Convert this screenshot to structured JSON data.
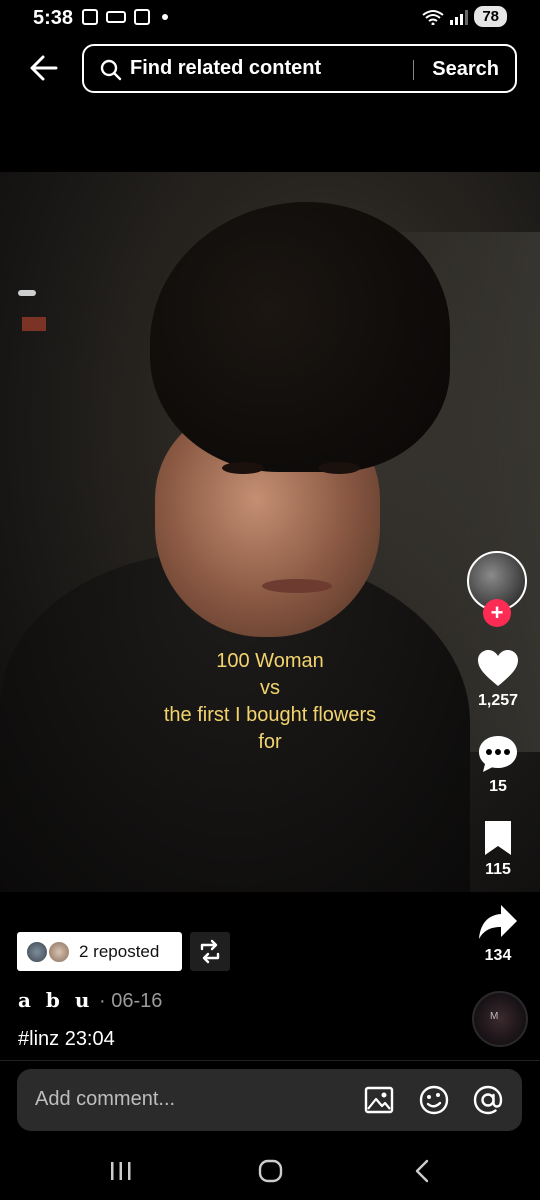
{
  "status": {
    "time": "5:38",
    "battery": "78"
  },
  "search": {
    "placeholder": "Find related content",
    "button": "Search"
  },
  "video": {
    "caption_lines": [
      "100 Woman",
      "vs",
      "the first I bought flowers",
      "for"
    ]
  },
  "rail": {
    "likes": "1,257",
    "comments": "15",
    "saves": "115",
    "shares": "134"
  },
  "meta": {
    "repost_label": "2 reposted",
    "author": "a b u",
    "date": "· 06-16",
    "hashtag": "#linz 23:04",
    "music_mark": "M"
  },
  "comment": {
    "placeholder": "Add comment..."
  },
  "colors": {
    "follow": "#fe2c55",
    "caption": "#f2d46e"
  }
}
